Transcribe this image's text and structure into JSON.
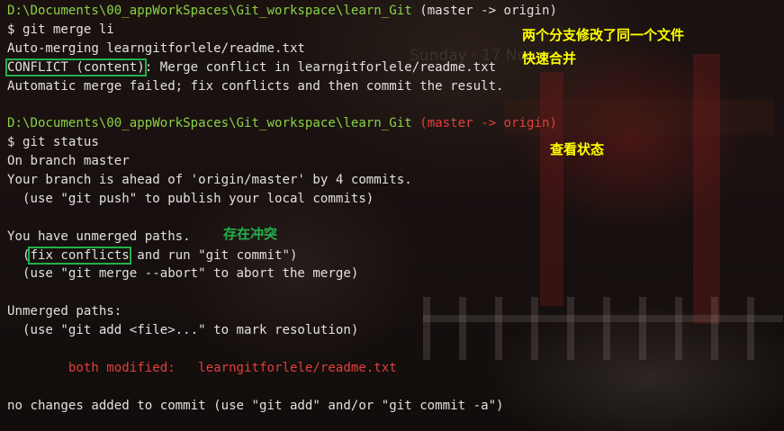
{
  "terminal": {
    "lines": [
      {
        "segments": [
          {
            "text": "D:\\Documents\\00_appWorkSpaces\\Git_workspace\\learn_Git",
            "color": "green"
          },
          {
            "text": " (master -> origin)",
            "color": "white"
          }
        ]
      },
      {
        "segments": [
          {
            "text": "$ git merge li",
            "color": "white"
          }
        ]
      },
      {
        "segments": [
          {
            "text": "Auto-merging learngitforlele/readme.txt",
            "color": "white"
          }
        ]
      },
      {
        "segments": [
          {
            "text": "CONFLICT (content)",
            "color": "white",
            "boxed": true
          },
          {
            "text": ": Merge conflict in learngitforlele/readme.txt",
            "color": "white"
          }
        ]
      },
      {
        "segments": [
          {
            "text": "Automatic merge failed; fix conflicts and then commit the result.",
            "color": "white"
          }
        ]
      },
      {
        "segments": []
      },
      {
        "segments": [
          {
            "text": "D:\\Documents\\00_appWorkSpaces\\Git_workspace\\learn_Git",
            "color": "green"
          },
          {
            "text": " (master -> origin)",
            "color": "red"
          }
        ]
      },
      {
        "segments": [
          {
            "text": "$ git status",
            "color": "white"
          }
        ]
      },
      {
        "segments": [
          {
            "text": "On branch master",
            "color": "white"
          }
        ]
      },
      {
        "segments": [
          {
            "text": "Your branch is ahead of 'origin/master' by 4 commits.",
            "color": "white"
          }
        ]
      },
      {
        "segments": [
          {
            "text": "  (use \"git push\" to publish your local commits)",
            "color": "white"
          }
        ]
      },
      {
        "segments": []
      },
      {
        "segments": [
          {
            "text": "You have unmerged paths.",
            "color": "white"
          }
        ]
      },
      {
        "segments": [
          {
            "text": "  (",
            "color": "white"
          },
          {
            "text": "fix conflicts",
            "color": "white",
            "boxed": true
          },
          {
            "text": " and run \"git commit\")",
            "color": "white"
          }
        ]
      },
      {
        "segments": [
          {
            "text": "  (use \"git merge --abort\" to abort the merge)",
            "color": "white"
          }
        ]
      },
      {
        "segments": []
      },
      {
        "segments": [
          {
            "text": "Unmerged paths:",
            "color": "white"
          }
        ]
      },
      {
        "segments": [
          {
            "text": "  (use \"git add <file>...\" to mark resolution)",
            "color": "white"
          }
        ]
      },
      {
        "segments": []
      },
      {
        "segments": [
          {
            "text": "        both modified:   learngitforlele/readme.txt",
            "color": "red"
          }
        ]
      },
      {
        "segments": []
      },
      {
        "segments": [
          {
            "text": "no changes added to commit (use \"git add\" and/or \"git commit -a\")",
            "color": "white"
          }
        ]
      }
    ]
  },
  "annotations": {
    "branch_conflict": "两个分支修改了同一个文件",
    "fast_merge": "快速合并",
    "view_status": "查看状态",
    "has_conflict": "存在冲突"
  },
  "background": {
    "ghost_text": "Sunday · 17 Novem"
  },
  "colors": {
    "path_green": "#8ad245",
    "branch_red": "#e0403c",
    "text_white": "#d8d8d8",
    "annotation_yellow": "#ffff00",
    "annotation_green": "#22b14c"
  }
}
